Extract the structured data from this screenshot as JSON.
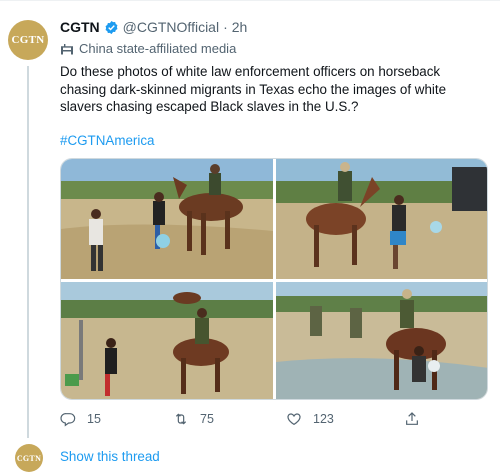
{
  "tweet": {
    "avatar_text": "CGTN",
    "display_name": "CGTN",
    "handle": "@CGTNOfficial",
    "separator": "·",
    "time": "2h",
    "affiliation_label": "China state-affiliated media",
    "text": "Do these photos of white law enforcement officers on horseback chasing dark-skinned migrants in Texas echo the images of white slavers chasing escaped Black slaves in the U.S.?",
    "hashtag": "#CGTNAmerica",
    "icons": {
      "verified": "verified-badge-icon",
      "affiliation": "flag-icon",
      "reply": "reply-icon",
      "retweet": "retweet-icon",
      "like": "heart-icon",
      "share": "share-icon"
    },
    "stats": {
      "replies": "15",
      "retweets": "75",
      "likes": "123"
    }
  },
  "thread": {
    "avatar_text": "CGTN",
    "show_thread_label": "Show this thread"
  },
  "colors": {
    "link": "#1d9bf0",
    "secondary_text": "#536471",
    "verified": "#1d9bf0",
    "avatar_bg": "#c7a85a"
  }
}
